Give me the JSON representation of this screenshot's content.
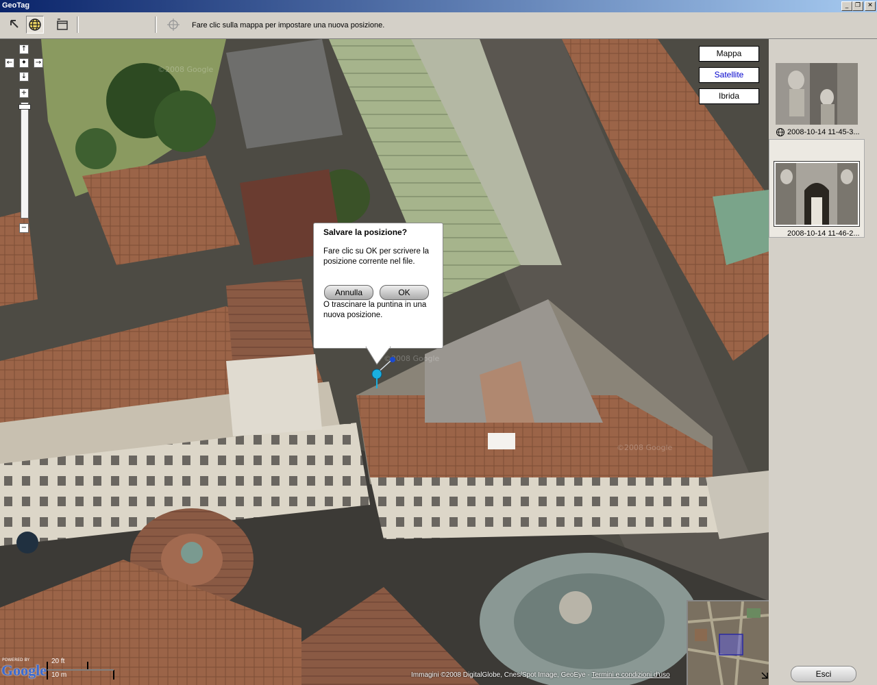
{
  "window": {
    "title": "GeoTag",
    "minimize": "_",
    "restore": "❐",
    "close": "✕"
  },
  "toolbar": {
    "hint": "Fare clic sulla mappa per impostare una nuova posizione.",
    "tools": [
      {
        "icon": "arrow-pointer-icon"
      },
      {
        "icon": "globe-icon",
        "active": true
      },
      {
        "icon": "window-icon"
      },
      {
        "icon": "crosshair-icon"
      }
    ]
  },
  "map": {
    "types": [
      "Mappa",
      "Satellite",
      "Ibrida"
    ],
    "selected_type": "Satellite",
    "nav": {
      "up": "↑",
      "down": "↓",
      "left": "←",
      "right": "→",
      "center": "✦",
      "zoom_in": "+",
      "zoom_out": "−"
    },
    "scale": {
      "top": "20 ft",
      "bottom": "10 m"
    },
    "logo": {
      "powered": "POWERED BY",
      "name": "Google"
    },
    "copyright": "Immagini ©2008 DigitalGlobe, Cnes/Spot Image, GeoEye - ",
    "terms": "Termini e condizioni d'uso",
    "watermark": "©2008 Google"
  },
  "dialog": {
    "title": "Salvare la posizione?",
    "body": "Fare clic su OK per scrivere la posizione corrente nel file.",
    "cancel": "Annulla",
    "ok": "OK",
    "alt": "O trascinare la puntina in una nuova posizione."
  },
  "photos": [
    {
      "caption": "2008-10-14 11-45-3...",
      "geotagged": true,
      "selected": false
    },
    {
      "caption": "2008-10-14 11-46-2...",
      "geotagged": false,
      "selected": true
    }
  ],
  "footer": {
    "exit": "Esci"
  },
  "colors": {
    "title_start": "#0a246a",
    "title_end": "#a6caf0",
    "selected_type": "#0000cc",
    "pin": "#1ab0e0"
  }
}
